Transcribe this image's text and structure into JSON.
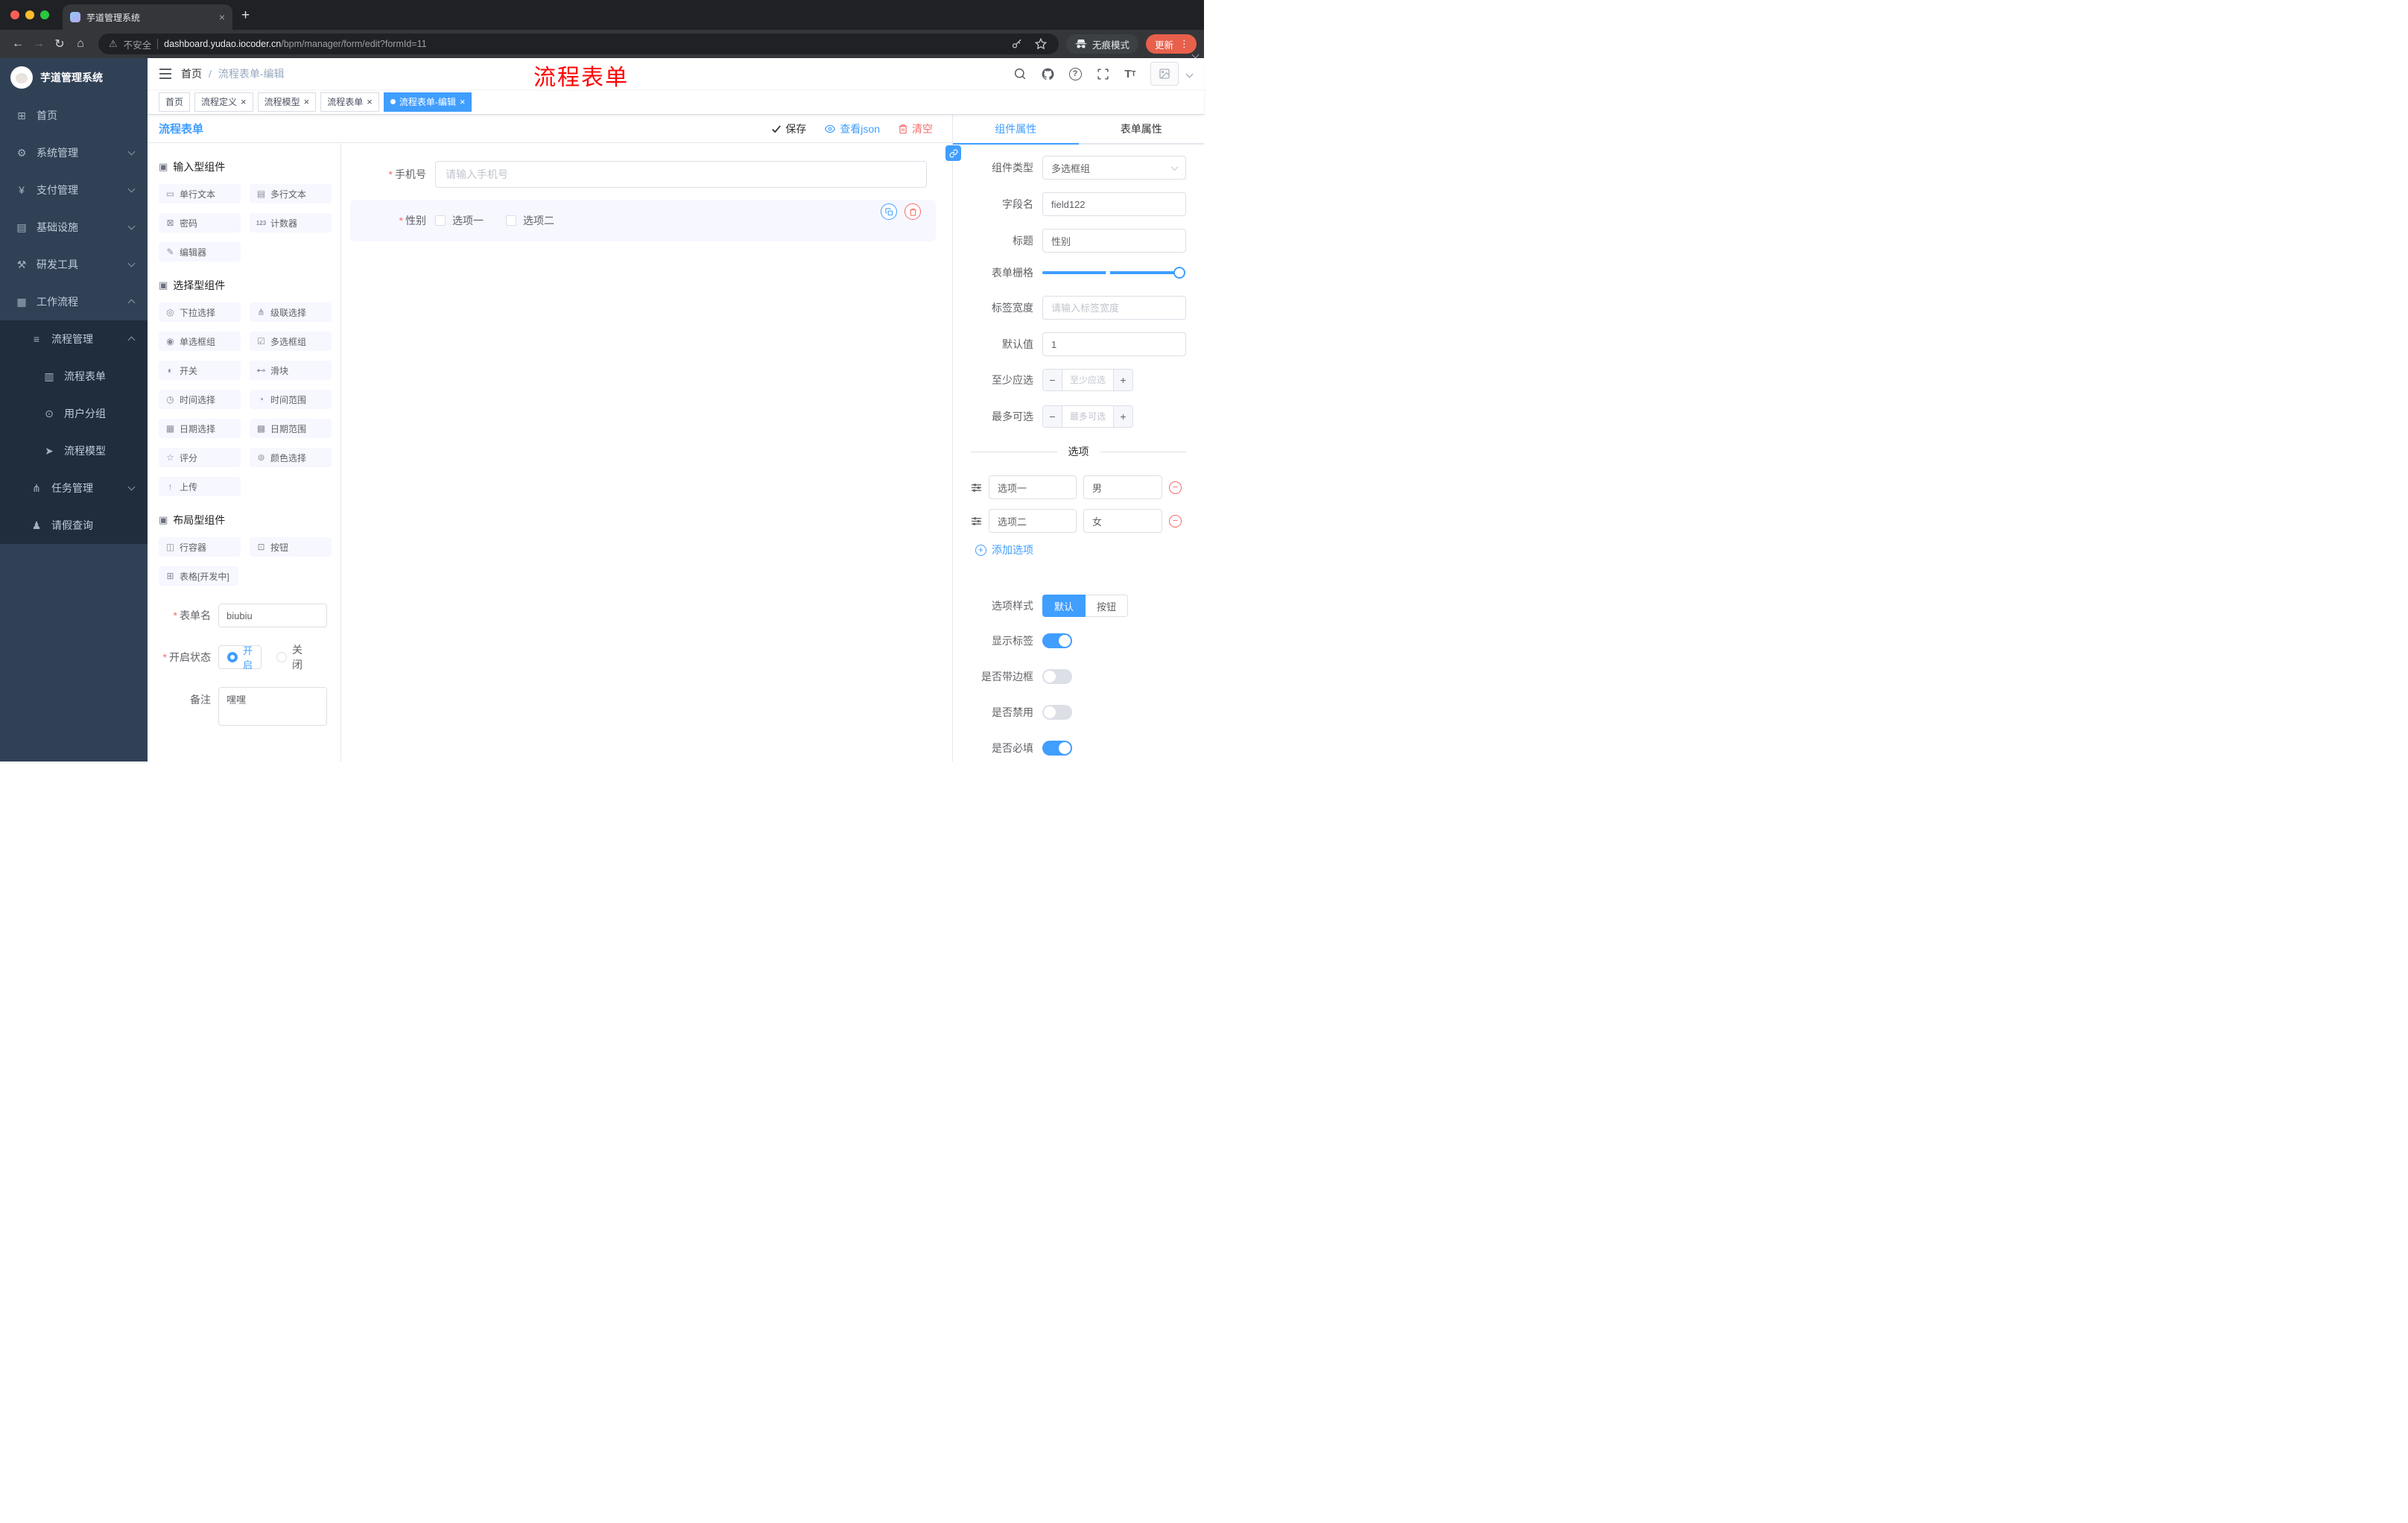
{
  "browser": {
    "tab_title": "芋道管理系统",
    "security_label": "不安全",
    "url_domain": "dashboard.yudao.iocoder.cn",
    "url_path": "/bpm/manager/form/edit?formId=11",
    "incognito_label": "无痕模式",
    "update_label": "更新"
  },
  "sidebar": {
    "logo_title": "芋道管理系统",
    "items": [
      {
        "label": "首页"
      },
      {
        "label": "系统管理"
      },
      {
        "label": "支付管理"
      },
      {
        "label": "基础设施"
      },
      {
        "label": "研发工具"
      },
      {
        "label": "工作流程"
      },
      {
        "label": "流程管理"
      },
      {
        "label": "流程表单"
      },
      {
        "label": "用户分组"
      },
      {
        "label": "流程模型"
      },
      {
        "label": "任务管理"
      },
      {
        "label": "请假查询"
      }
    ]
  },
  "header": {
    "breadcrumb_home": "首页",
    "breadcrumb_sep": "/",
    "breadcrumb_current": "流程表单-编辑",
    "overlay_title": "流程表单"
  },
  "tags": [
    {
      "label": "首页"
    },
    {
      "label": "流程定义"
    },
    {
      "label": "流程模型"
    },
    {
      "label": "流程表单"
    },
    {
      "label": "流程表单-编辑"
    }
  ],
  "designer": {
    "panel_title": "流程表单",
    "toolbar": {
      "save": "保存",
      "view_json": "查看json",
      "clear": "清空"
    },
    "palette": {
      "sections": [
        {
          "title": "输入型组件",
          "items": [
            "单行文本",
            "多行文本",
            "密码",
            "计数器",
            "编辑器"
          ]
        },
        {
          "title": "选择型组件",
          "items": [
            "下拉选择",
            "级联选择",
            "单选框组",
            "多选框组",
            "开关",
            "滑块",
            "时间选择",
            "时间范围",
            "日期选择",
            "日期范围",
            "评分",
            "颜色选择",
            "上传"
          ]
        },
        {
          "title": "布局型组件",
          "items": [
            "行容器",
            "按钮",
            "表格[开发中]"
          ]
        }
      ]
    },
    "meta_form": {
      "name_label": "表单名",
      "name_value": "biubiu",
      "status_label": "开启状态",
      "status_on": "开启",
      "status_off": "关闭",
      "remark_label": "备注",
      "remark_value": "嘿嘿"
    }
  },
  "canvas": {
    "phone": {
      "label": "手机号",
      "placeholder": "请输入手机号"
    },
    "gender": {
      "label": "性别",
      "options": [
        "选项一",
        "选项二"
      ]
    }
  },
  "props": {
    "tab_component": "组件属性",
    "tab_form": "表单属性",
    "rows": {
      "type_label": "组件类型",
      "type_value": "多选框组",
      "field_label": "字段名",
      "field_value": "field122",
      "title_label": "标题",
      "title_value": "性别",
      "grid_label": "表单栅格",
      "width_label": "标签宽度",
      "width_placeholder": "请输入标签宽度",
      "default_label": "默认值",
      "default_value": "1",
      "min_label": "至少应选",
      "min_placeholder": "至少应选",
      "max_label": "最多可选",
      "max_placeholder": "最多可选"
    },
    "options": {
      "divider": "选项",
      "items": [
        {
          "label": "选项一",
          "value": "男"
        },
        {
          "label": "选项二",
          "value": "女"
        }
      ],
      "add": "添加选项"
    },
    "style": {
      "label": "选项样式",
      "opt_default": "默认",
      "opt_button": "按钮"
    },
    "switches": [
      {
        "label": "显示标签",
        "on": true
      },
      {
        "label": "是否带边框",
        "on": false
      },
      {
        "label": "是否禁用",
        "on": false
      },
      {
        "label": "是否必填",
        "on": true
      }
    ]
  },
  "colors": {
    "accent": "#409eff",
    "danger": "#f56c6c",
    "title_red": "#ff0000"
  }
}
